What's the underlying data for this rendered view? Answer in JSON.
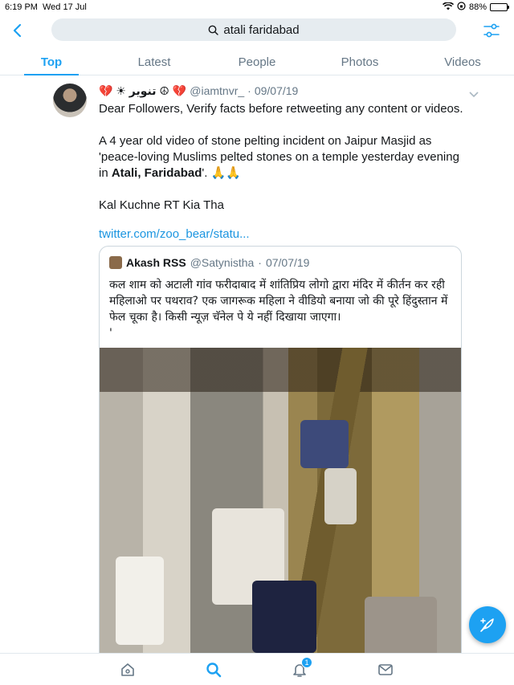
{
  "status_bar": {
    "time": "6:19 PM",
    "date": "Wed 17 Jul",
    "battery": "88%",
    "battery_level": 0.88
  },
  "search": {
    "query": "atali faridabad",
    "back_icon": "chevron-left-icon",
    "filter_icon": "sliders-icon"
  },
  "tabs": [
    {
      "label": "Top",
      "active": true
    },
    {
      "label": "Latest",
      "active": false
    },
    {
      "label": "People",
      "active": false
    },
    {
      "label": "Photos",
      "active": false
    },
    {
      "label": "Videos",
      "active": false
    }
  ],
  "tweet": {
    "display_name": "💔 ☀ تنویر ☮ 💔",
    "handle": "@iamtnvr_",
    "separator": "·",
    "date": "09/07/19",
    "para1": "Dear Followers, Verify facts before retweeting any content or videos.",
    "para2_pre": "A 4 year old video of stone pelting incident on Jaipur Masjid as 'peace-loving Muslims pelted stones on a temple yesterday evening in ",
    "para2_bold": "Atali, Faridabad",
    "para2_post": "'. 🙏🙏",
    "para3": "Kal Kuchne RT Kia Tha",
    "link": "twitter.com/zoo_bear/statu..."
  },
  "quote": {
    "display_name": "Akash RSS",
    "handle": "@Satynistha",
    "separator": "·",
    "date": "07/07/19",
    "text": "कल शाम को अटाली गांव फरीदाबाद में शांतिप्रिय लोगो द्वारा मंदिर में कीर्तन कर रही महिलाओ पर पथराव? एक जागरूक महिला ने वीडियो बनाया जो की पूरे हिंदुस्तान में फेल चूका है। किसी न्यूज़ चॅनेल पे ये नहीं दिखाया जाएगा।",
    "trailing": "'"
  },
  "fab": {
    "icon": "compose-feather-icon"
  },
  "bottom_nav": {
    "notifications_badge": "1",
    "items": [
      "home-icon",
      "search-icon",
      "notifications-icon",
      "messages-icon"
    ]
  },
  "colors": {
    "accent": "#1da1f2",
    "link": "#1b95e0",
    "secondary_text": "#657786",
    "search_bg": "#e6ecf0"
  }
}
